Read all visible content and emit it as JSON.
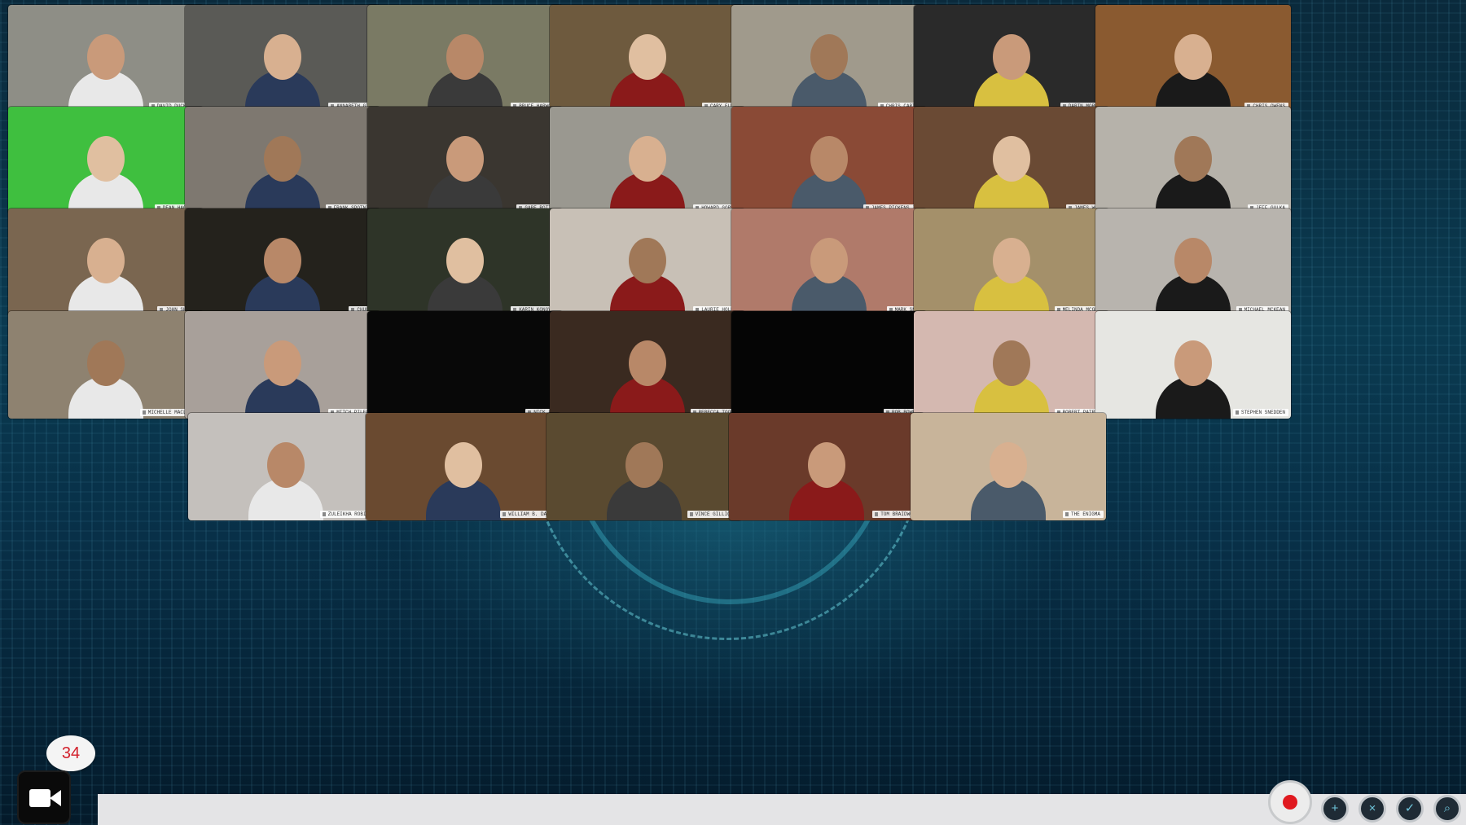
{
  "participant_count": "34",
  "accent_colors": {
    "record": "#e0191f",
    "count_text": "#d21f2a",
    "background": "#0a3a50"
  },
  "rows": [
    [
      {
        "name": "DAVID DUCHOVNY",
        "bg": "#8e8e86"
      },
      {
        "name": "ANNABETH GISH",
        "bg": "#5a5a56"
      },
      {
        "name": "BRUCE HARWOOD",
        "bg": "#7a7a64"
      },
      {
        "name": "CARY ELWES",
        "bg": "#6e5a3e"
      },
      {
        "name": "CHRIS CARTER",
        "bg": "#a09a8c"
      },
      {
        "name": "DARIN MORGAN",
        "bg": "#2a2a2a"
      },
      {
        "name": "CHRIS OWENS",
        "bg": "#8a5a30"
      }
    ],
    [
      {
        "name": "DEAN HAGLUND",
        "bg": "#3fbf3f"
      },
      {
        "name": "FRANK SPOTNITZ",
        "bg": "#7e7870"
      },
      {
        "name": "GABE ROTTER",
        "bg": "#3a3630"
      },
      {
        "name": "HOWARD GORDON",
        "bg": "#9a9890"
      },
      {
        "name": "JAMES PICKENS JR.",
        "bg": "#8a4a36"
      },
      {
        "name": "JAMES WONG",
        "bg": "#6a4a34"
      },
      {
        "name": "JEFF GULKA",
        "bg": "#b6b2aa"
      }
    ],
    [
      {
        "name": "JOHN SHIBAN",
        "bg": "#7a6650"
      },
      {
        "name": "CHUCKY",
        "bg": "#24221c"
      },
      {
        "name": "KARIN KONOVAL",
        "bg": "#2e3428"
      },
      {
        "name": "LAURIE HOLDEN",
        "bg": "#c8c0b6"
      },
      {
        "name": "MARK SNOW",
        "bg": "#b07a6a"
      },
      {
        "name": "MELINDA MCGRAW",
        "bg": "#a4906a"
      },
      {
        "name": "MICHAEL MCKEAN",
        "bg": "#b8b4ae"
      }
    ],
    [
      {
        "name": "MICHELLE MACLAREN",
        "bg": "#8e8270"
      },
      {
        "name": "MITCH PILEGGI",
        "bg": "#a8a09a"
      },
      {
        "name": "NICK LEA",
        "bg": "#080808"
      },
      {
        "name": "REBECCA TOOLAN",
        "bg": "#3a2a20"
      },
      {
        "name": "ROB BOWMAN",
        "bg": "#050505"
      },
      {
        "name": "ROBERT PATRICK",
        "bg": "#d4b8b0"
      },
      {
        "name": "STEPHEN SNEDDEN",
        "bg": "#e6e6e2"
      }
    ],
    [
      {
        "name": "ZULEIKHA ROBINSON",
        "bg": "#c4c0bc"
      },
      {
        "name": "WILLIAM B. DAVIS",
        "bg": "#6a4a30"
      },
      {
        "name": "VINCE GILLIGAN",
        "bg": "#5a4a30"
      },
      {
        "name": "TOM BRAIDWOOD",
        "bg": "#6a3a2a"
      },
      {
        "name": "THE ENIGMA",
        "bg": "#c8b49a"
      }
    ]
  ],
  "controls": [
    {
      "icon": "plus-icon",
      "glyph": "+"
    },
    {
      "icon": "close-icon",
      "glyph": "×"
    },
    {
      "icon": "check-icon",
      "glyph": "✓"
    },
    {
      "icon": "search-icon",
      "glyph": "⌕"
    }
  ]
}
